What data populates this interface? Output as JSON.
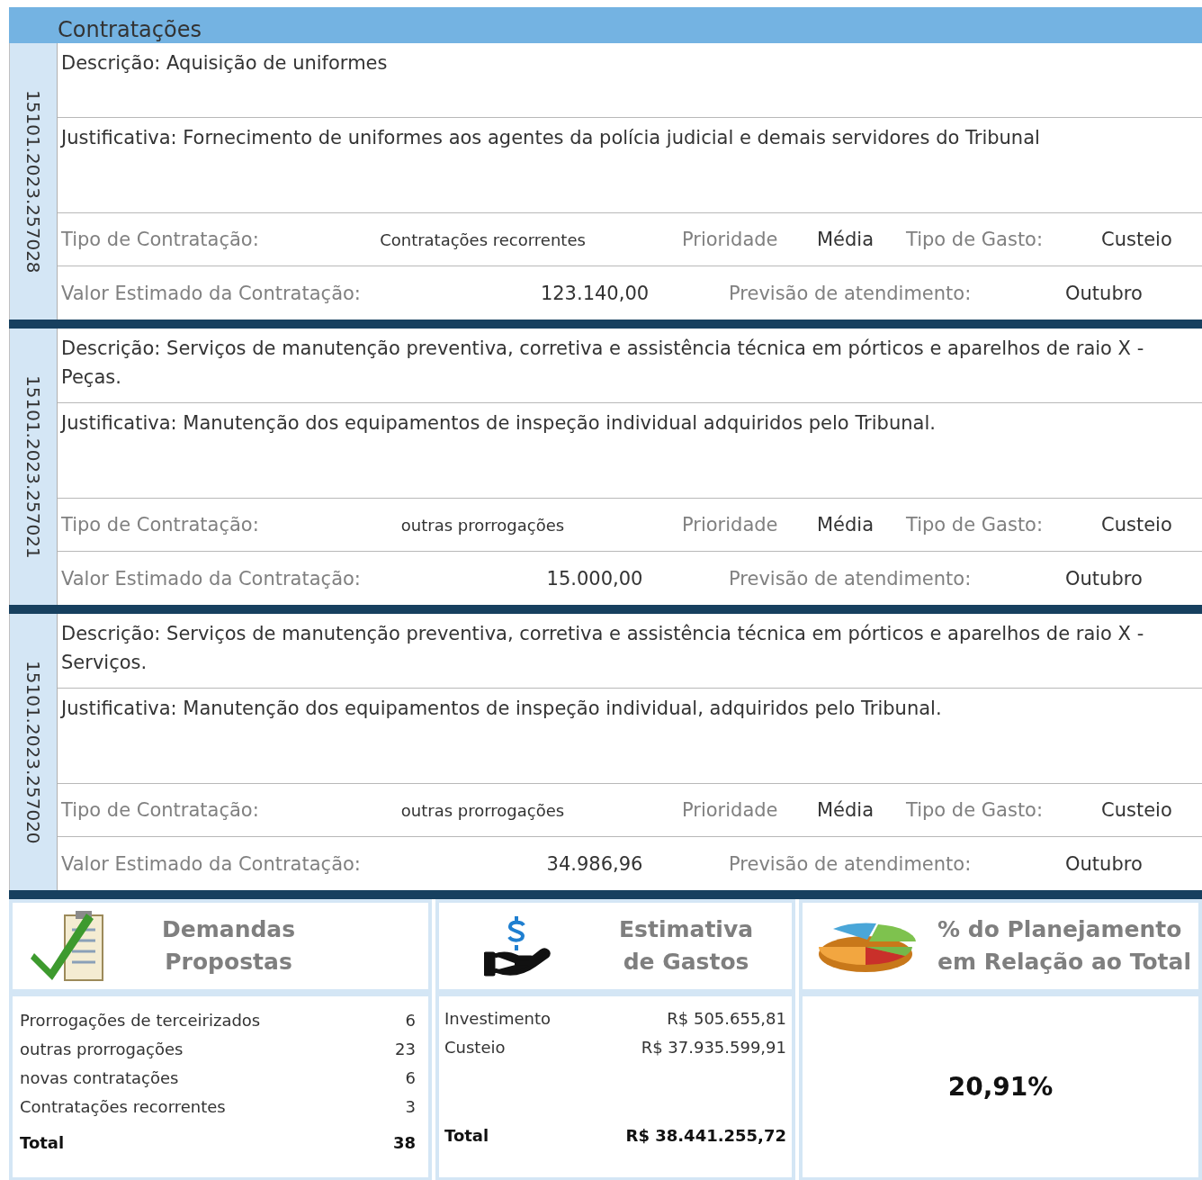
{
  "section_title": "Contratações",
  "records": [
    {
      "id": "15101.2023.257028",
      "description": "Descrição: Aquisição de uniformes",
      "justification": "Justificativa: Fornecimento de uniformes aos agentes da polícia judicial e demais servidores do Tribunal",
      "contract_type_label": "Tipo de Contratação:",
      "contract_type": "Contratações recorrentes",
      "priority_label": "Prioridade",
      "priority": "Média",
      "expense_type_label": "Tipo de Gasto:",
      "expense_type": "Custeio",
      "value_label": "Valor Estimado da Contratação:",
      "value": "123.140,00",
      "forecast_label": "Previsão de atendimento:",
      "forecast": "Outubro"
    },
    {
      "id": "15101.2023.257021",
      "description": "Descrição: Serviços de manutenção preventiva, corretiva e assistência técnica em pórticos e aparelhos de raio X - Peças.",
      "justification": "Justificativa: Manutenção dos equipamentos de inspeção individual adquiridos pelo Tribunal.",
      "contract_type_label": "Tipo de Contratação:",
      "contract_type": "outras prorrogações",
      "priority_label": "Prioridade",
      "priority": "Média",
      "expense_type_label": "Tipo de Gasto:",
      "expense_type": "Custeio",
      "value_label": "Valor Estimado da Contratação:",
      "value": "15.000,00",
      "forecast_label": "Previsão de atendimento:",
      "forecast": "Outubro"
    },
    {
      "id": "15101.2023.257020",
      "description": "Descrição: Serviços de manutenção preventiva, corretiva e assistência técnica em pórticos e aparelhos de raio X - Serviços.",
      "justification": "Justificativa: Manutenção dos equipamentos de inspeção individual, adquiridos pelo Tribunal.",
      "contract_type_label": "Tipo de Contratação:",
      "contract_type": "outras prorrogações",
      "priority_label": "Prioridade",
      "priority": "Média",
      "expense_type_label": "Tipo de Gasto:",
      "expense_type": "Custeio",
      "value_label": "Valor Estimado da Contratação:",
      "value": "34.986,96",
      "forecast_label": "Previsão de atendimento:",
      "forecast": "Outubro"
    }
  ],
  "demands": {
    "title_lines": [
      "Demandas",
      "Propostas"
    ],
    "rows": [
      {
        "label": "Prorrogações de terceirizados",
        "count": "6"
      },
      {
        "label": "outras prorrogações",
        "count": "23"
      },
      {
        "label": "novas contratações",
        "count": "6"
      },
      {
        "label": "Contratações recorrentes",
        "count": "3"
      }
    ],
    "total_label": "Total",
    "total": "38"
  },
  "spending": {
    "title_lines": [
      "Estimativa",
      "de Gastos"
    ],
    "rows": [
      {
        "label": "Investimento",
        "amount": "R$ 505.655,81"
      },
      {
        "label": "Custeio",
        "amount": "R$ 37.935.599,91"
      }
    ],
    "total_label": "Total",
    "total": "R$ 38.441.255,72"
  },
  "planning": {
    "title_lines": [
      "% do Planejamento",
      "em Relação ao Total"
    ],
    "percent": "20,91%"
  }
}
